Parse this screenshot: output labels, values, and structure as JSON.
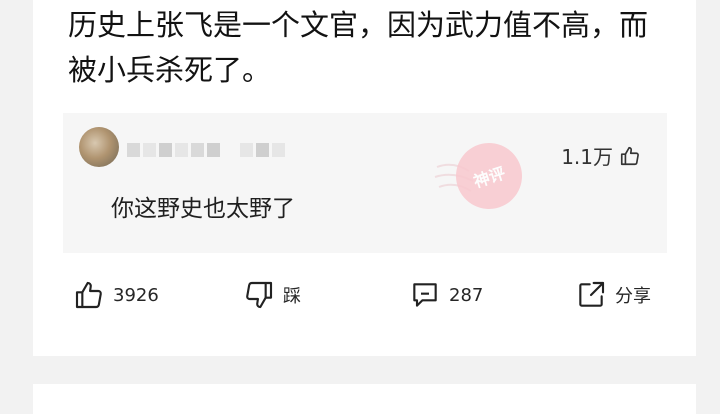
{
  "post": {
    "text": "历史上张飞是一个文官，因为武力值不高，而被小兵杀死了。"
  },
  "hot_comment": {
    "likes": "1.1万",
    "text": "你这野史也太野了",
    "stamp": "神评"
  },
  "actions": {
    "like_count": "3926",
    "dislike_label": "踩",
    "comment_count": "287",
    "share_label": "分享"
  },
  "colors": {
    "card_bg": "#ffffff",
    "page_bg": "#f2f2f2",
    "comment_bg": "#f6f6f6",
    "stamp": "#f9c9cf"
  },
  "icons": [
    "thumbs-up-icon",
    "thumbs-down-icon",
    "comment-icon",
    "share-icon"
  ]
}
